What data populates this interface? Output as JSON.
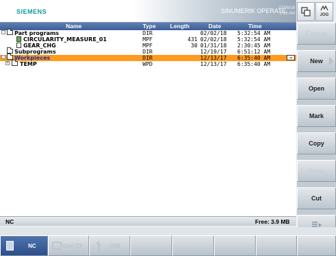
{
  "header": {
    "brand": "SIEMENS",
    "product": "SINUMERIK OPERATE",
    "date": "02/06/18",
    "time": "5:16 AM",
    "jog_label": "JOG"
  },
  "columns": {
    "name": "Name",
    "type": "Type",
    "length": "Length",
    "date": "Date",
    "time": "Time"
  },
  "rows": [
    {
      "name": "Part programs",
      "type": "DIR",
      "length": "",
      "date": "02/02/18",
      "time": "5:32:54 AM",
      "level": 0,
      "kind": "folder",
      "selected": false
    },
    {
      "name": "CIRCULARITY_MEASURE_01",
      "type": "MPF",
      "length": "431",
      "date": "02/02/18",
      "time": "5:32:54 AM",
      "level": 1,
      "kind": "file-green",
      "selected": false
    },
    {
      "name": "GEAR_CHG",
      "type": "MPF",
      "length": "30",
      "date": "01/31/18",
      "time": "2:30:45 AM",
      "level": 1,
      "kind": "file",
      "selected": false
    },
    {
      "name": "Subprograms",
      "type": "DIR",
      "length": "",
      "date": "12/19/17",
      "time": "6:51:12 AM",
      "level": 0,
      "kind": "folder",
      "selected": false
    },
    {
      "name": "Workpieces",
      "type": "DIR",
      "length": "",
      "date": "12/13/17",
      "time": "6:35:40 AM",
      "level": 0,
      "kind": "folder",
      "selected": true
    },
    {
      "name": "TEMP",
      "type": "WPD",
      "length": "",
      "date": "12/13/17",
      "time": "6:35:40 AM",
      "level": 1,
      "kind": "folder",
      "selected": false
    }
  ],
  "status": {
    "drive": "NC",
    "free": "Free: 3.9 MB"
  },
  "softkeys_right": [
    "Execute",
    "New",
    "Open",
    "Mark",
    "Copy",
    "Paste",
    "Cut",
    ""
  ],
  "softkeys_bottom": [
    "NC",
    "User CF",
    "USB",
    "",
    "",
    "",
    ""
  ],
  "colors": {
    "selection": "#ff9a1f",
    "header_blue": "#3e5f96",
    "brand_teal": "#0a9aa0"
  }
}
